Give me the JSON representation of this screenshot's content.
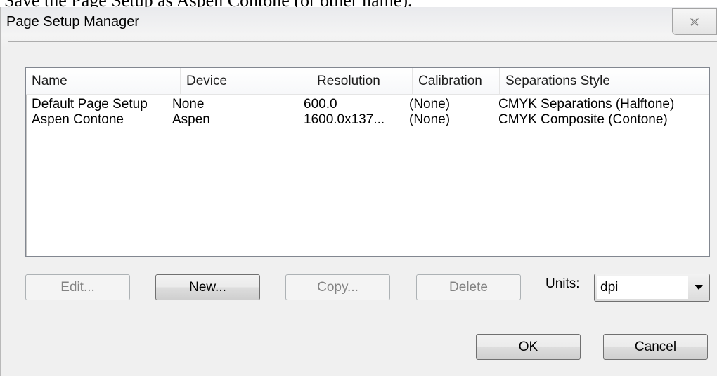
{
  "document": {
    "caption": "Save the Page Setup as Aspen Contone (or other name)."
  },
  "window": {
    "title": "Page Setup Manager",
    "close_icon": "close-icon"
  },
  "table": {
    "columns": [
      "Name",
      "Device",
      "Resolution",
      "Calibration",
      "Separations Style"
    ],
    "rows": [
      [
        "Default Page Setup",
        "None",
        "600.0",
        "(None)",
        "CMYK Separations (Halftone)"
      ],
      [
        "Aspen Contone",
        "Aspen",
        "1600.0x137...",
        "(None)",
        "CMYK Composite (Contone)"
      ]
    ]
  },
  "buttons": {
    "edit": "Edit...",
    "new": "New...",
    "copy": "Copy...",
    "delete": "Delete",
    "ok": "OK",
    "cancel": "Cancel"
  },
  "units": {
    "label": "Units:",
    "value": "dpi",
    "icon": "chevron-down-icon"
  }
}
